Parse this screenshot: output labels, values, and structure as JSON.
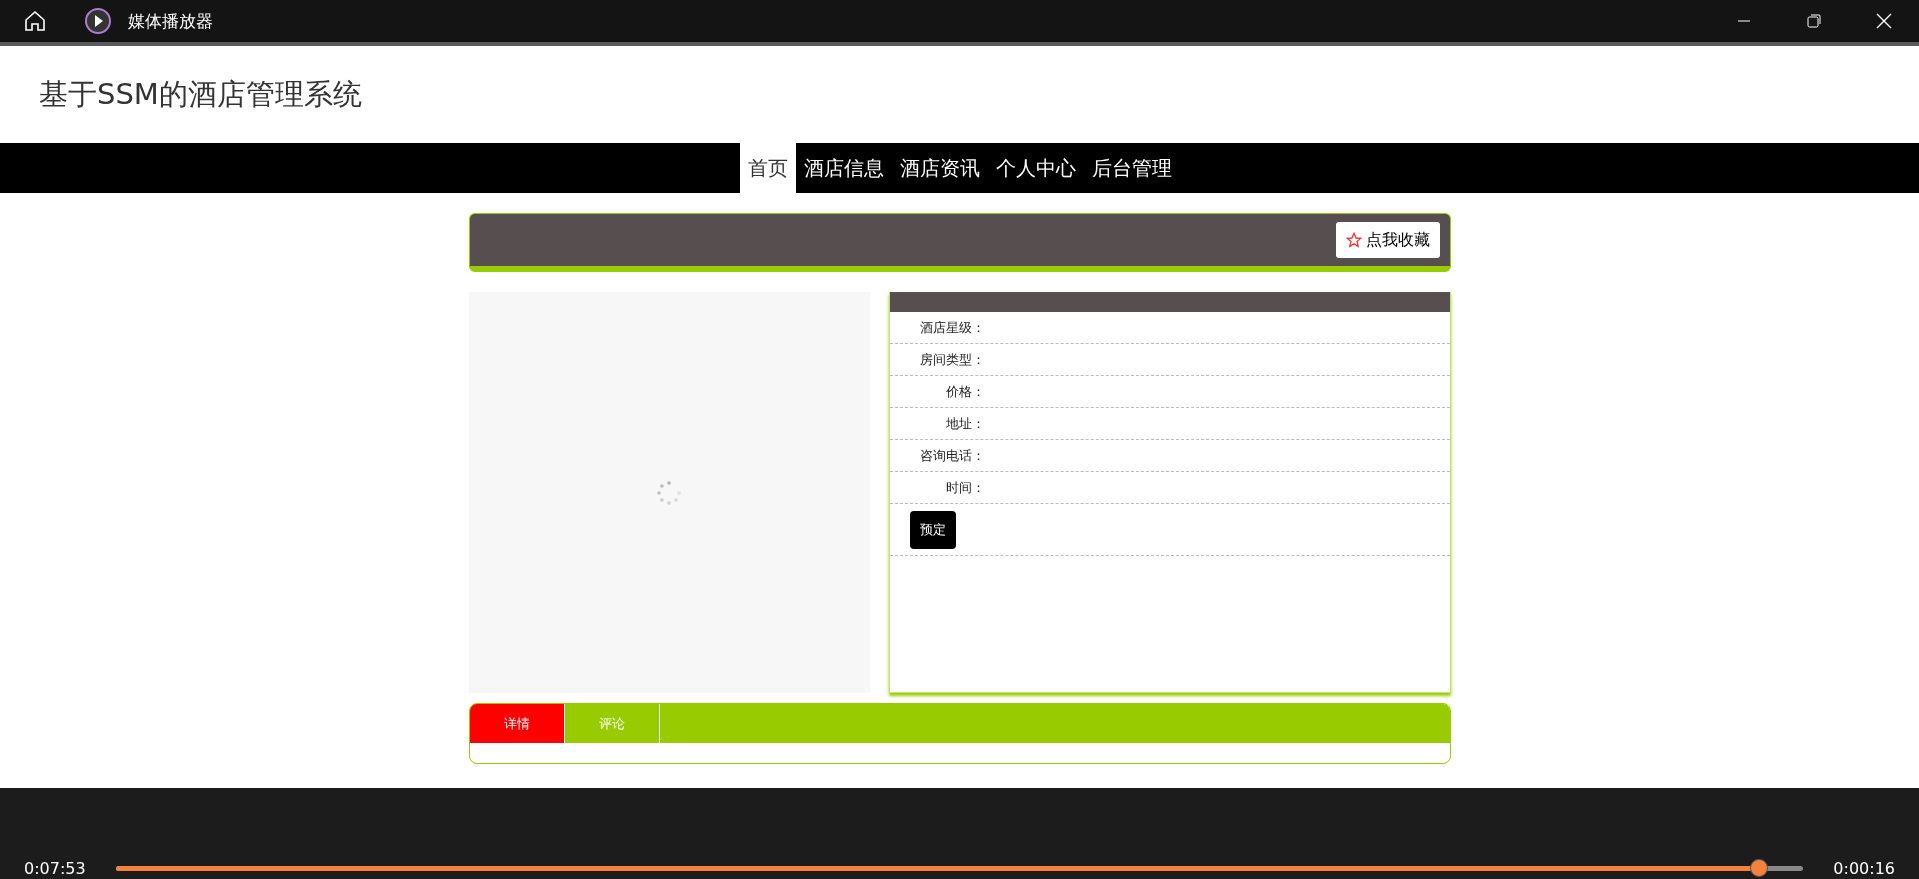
{
  "window": {
    "title": "媒体播放器"
  },
  "site": {
    "title": "基于SSM的酒店管理系统"
  },
  "nav": [
    {
      "label": "首页",
      "selected": true
    },
    {
      "label": "酒店信息",
      "selected": false
    },
    {
      "label": "酒店资讯",
      "selected": false
    },
    {
      "label": "个人中心",
      "selected": false
    },
    {
      "label": "后台管理",
      "selected": false
    }
  ],
  "favorite_button": "点我收藏",
  "details": [
    {
      "label": "酒店星级："
    },
    {
      "label": "房间类型："
    },
    {
      "label": "价格："
    },
    {
      "label": "地址："
    },
    {
      "label": "咨询电话："
    },
    {
      "label": "时间："
    }
  ],
  "book_button": "预定",
  "tabs": [
    {
      "label": "详情",
      "selected": true
    },
    {
      "label": "评论",
      "selected": false
    }
  ],
  "player": {
    "elapsed": "0:07:53",
    "remaining": "0:00:16",
    "level": 0.974
  }
}
